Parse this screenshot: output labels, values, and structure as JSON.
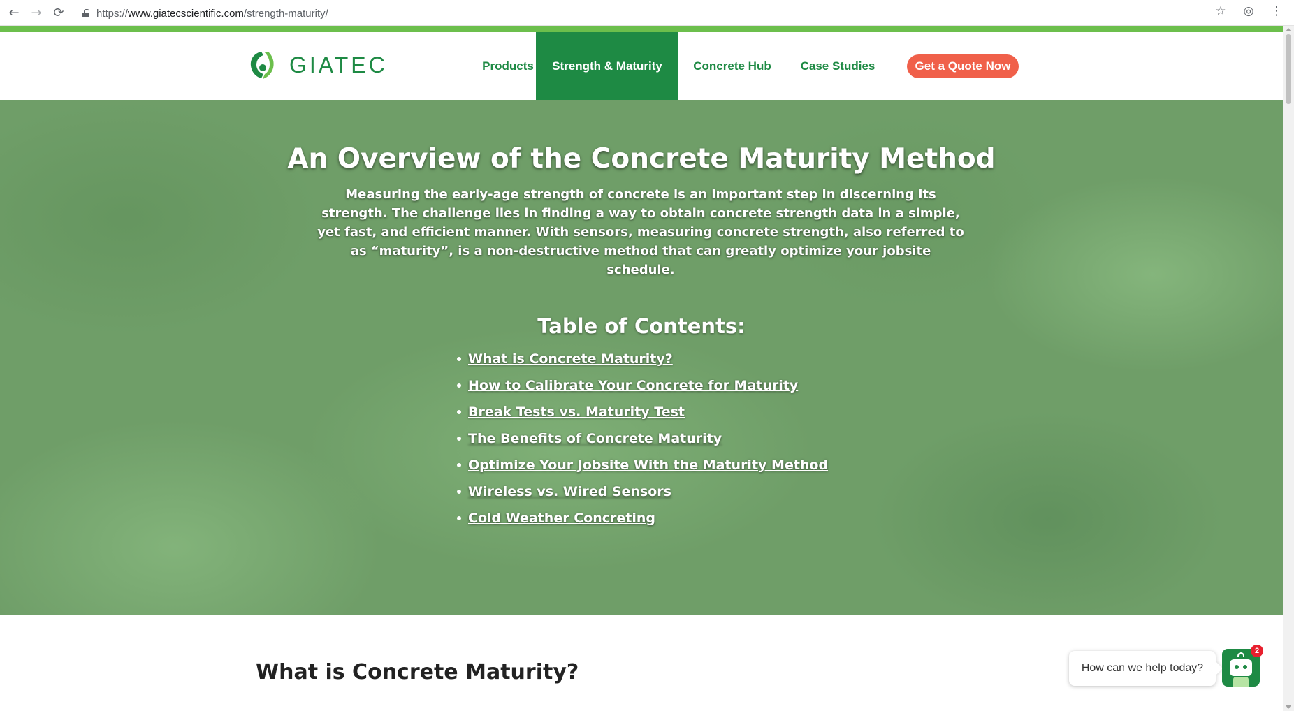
{
  "browser": {
    "url_scheme": "https://",
    "url_host": "www.giatecscientific.com",
    "url_path": "/strength-maturity/",
    "back_icon": "←",
    "forward_icon": "→",
    "reload_icon": "⟳",
    "star_icon": "☆",
    "incognito_icon": "◎",
    "menu_icon": "⋮"
  },
  "header": {
    "logo_text": "GIATEC",
    "nav": [
      {
        "label": "Products"
      },
      {
        "label": "Strength & Maturity"
      },
      {
        "label": "Concrete Hub"
      },
      {
        "label": "Case Studies"
      }
    ],
    "cta_label": "Get a Quote Now"
  },
  "hero": {
    "title": "An Overview of the Concrete Maturity Method",
    "intro": "Measuring the early-age strength of concrete is an important step in discerning its strength. The challenge lies in finding a way to obtain concrete strength data in a simple, yet fast, and efficient manner. With sensors, measuring concrete strength, also referred to as “maturity”, is a non-destructive method that can greatly optimize your jobsite schedule.",
    "toc_heading": "Table of Contents:",
    "toc": [
      {
        "label": "What is Concrete Maturity?"
      },
      {
        "label": "How to Calibrate Your Concrete for Maturity"
      },
      {
        "label": "Break Tests vs. Maturity Test"
      },
      {
        "label": "The Benefits of Concrete Maturity"
      },
      {
        "label": "Optimize Your Jobsite With the Maturity Method"
      },
      {
        "label": "Wireless vs. Wired Sensors"
      },
      {
        "label": "Cold Weather Concreting"
      }
    ]
  },
  "section": {
    "title": "What is Concrete Maturity?"
  },
  "chat": {
    "prompt": "How can we help today?",
    "badge_count": "2"
  },
  "colors": {
    "brand_green": "#1e8a44",
    "accent_green": "#6cbf4c",
    "cta_orange": "#f0604a"
  }
}
